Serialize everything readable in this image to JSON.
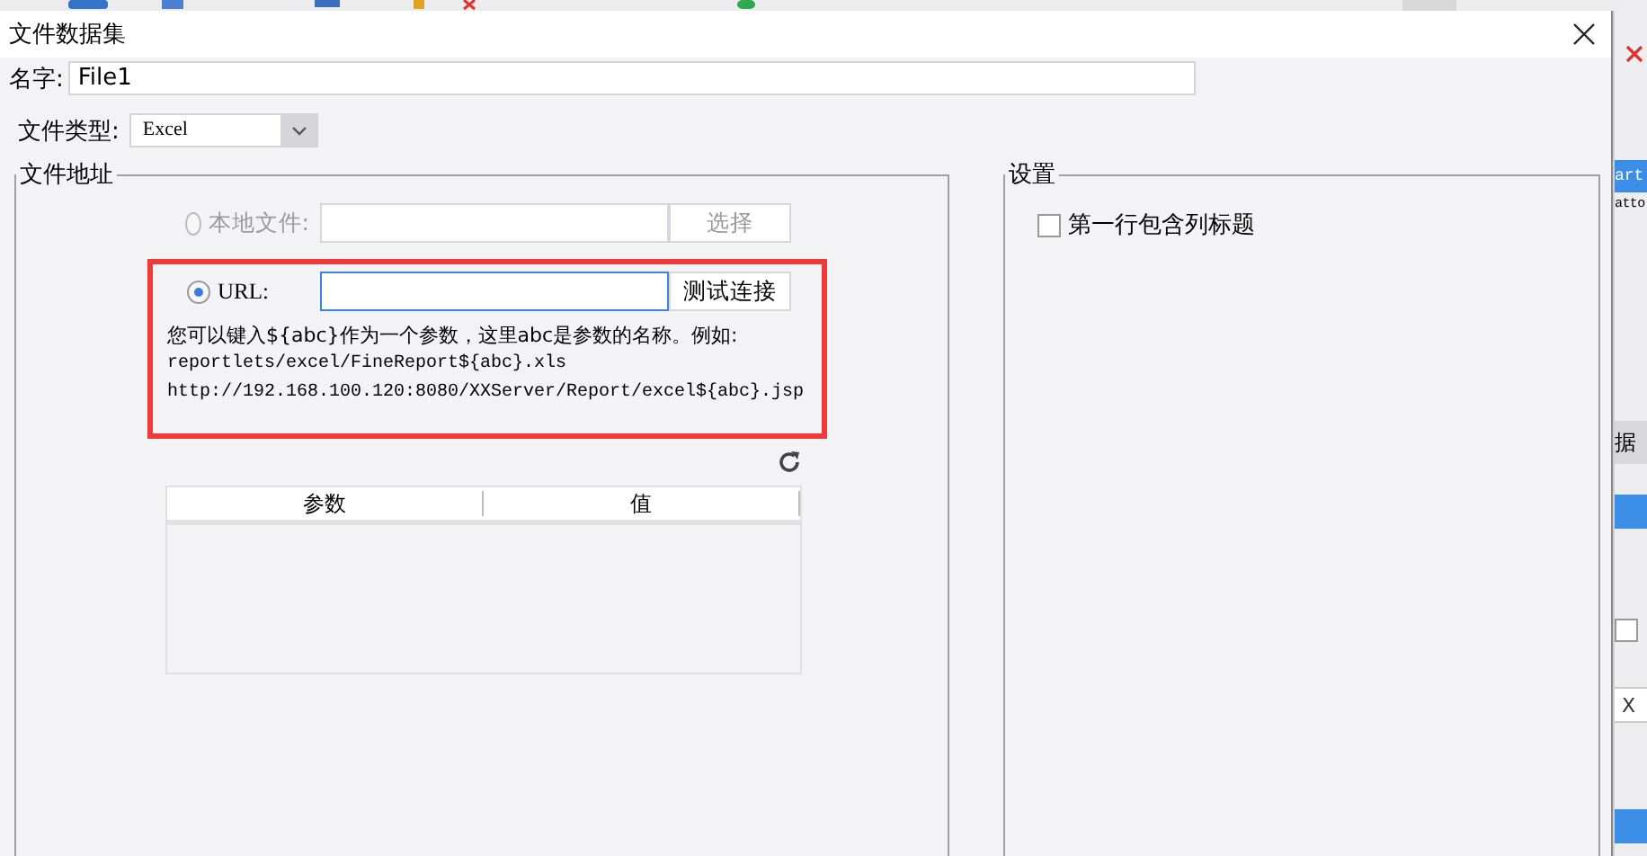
{
  "window": {
    "title": "文件数据集"
  },
  "name_field": {
    "label": "名字:",
    "value": "File1"
  },
  "file_type": {
    "label": "文件类型:",
    "value": "Excel"
  },
  "file_address": {
    "legend": "文件地址",
    "sources": [
      {
        "label": "本地文件:",
        "selected": false,
        "disabled": true,
        "focused": false,
        "button": "选择"
      },
      {
        "label": "URL:",
        "selected": true,
        "disabled": false,
        "focused": true,
        "button": "测试连接"
      }
    ],
    "help": {
      "intro": "您可以键入${abc}作为一个参数，这里abc是参数的名称。例如:",
      "examples": [
        "reportlets/excel/FineReport${abc}.xls",
        "http://192.168.100.120:8080/XXServer/Report/excel${abc}.jsp"
      ]
    },
    "params_table": {
      "columns": [
        "参数",
        "值"
      ]
    }
  },
  "settings": {
    "legend": "设置",
    "options": [
      {
        "label": "第一行包含列标题",
        "checked": false
      }
    ]
  },
  "background_panel": {
    "texts": [
      "art",
      "atto",
      "据",
      "X"
    ],
    "checkbox": {
      "checked": false
    }
  }
}
